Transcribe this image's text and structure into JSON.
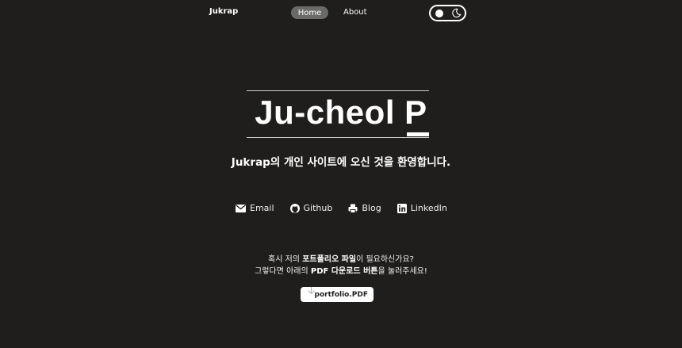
{
  "nav": {
    "brand": "Jukrap",
    "home": "Home",
    "about": "About",
    "theme_toggle": {
      "icons": [
        "sun-icon",
        "moon-icon"
      ]
    }
  },
  "hero": {
    "title": "Ju-cheol P",
    "subtitle": "Jukrap의 개인 사이트에 오신 것을 환영합니다."
  },
  "links": [
    {
      "label": "Email",
      "icon": "mail-icon"
    },
    {
      "label": "Github",
      "icon": "github-icon"
    },
    {
      "label": "Blog",
      "icon": "blog-icon"
    },
    {
      "label": "LinkedIn",
      "icon": "linkedin-icon"
    }
  ],
  "portfolio": {
    "line1_pre": "혹시 저의 ",
    "line1_bold": "포트폴리오 파일",
    "line1_post": "이 필요하신가요?",
    "line2_pre": "그렇다면 아래의 ",
    "line2_bold": "PDF 다운로드 버튼",
    "line2_post": "을 눌러주세요!",
    "button_label": "portfolio.PDF"
  },
  "colors": {
    "background": "#1f1e1c",
    "text": "#ffffff",
    "nav_active": "#6a6a68"
  }
}
